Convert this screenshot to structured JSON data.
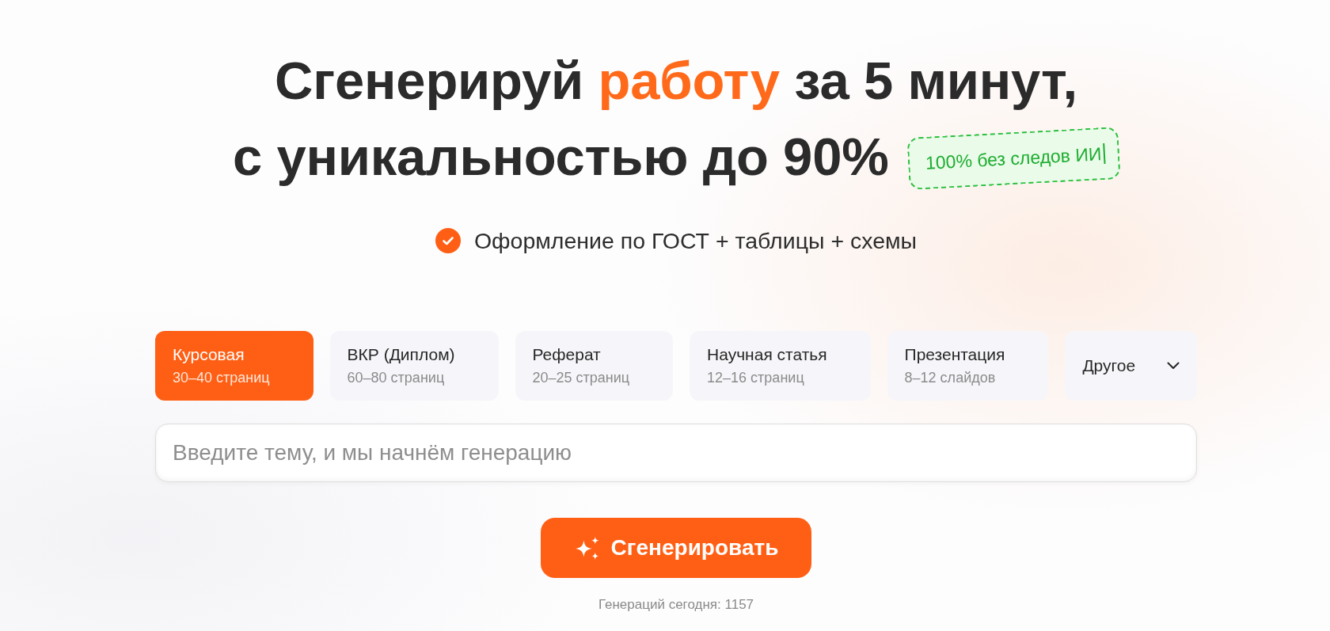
{
  "headline": {
    "lines": [
      {
        "segments": [
          {
            "text": "Сгенерируй ",
            "accent": false
          },
          {
            "text": "работу",
            "accent": true
          },
          {
            "text": " за 5 минут,",
            "accent": false
          }
        ]
      },
      {
        "segments": [
          {
            "text": "с уникальностью до 90%",
            "accent": false
          }
        ],
        "badge": {
          "text": "100% без следов ИИ",
          "caret": true
        }
      }
    ]
  },
  "feature": {
    "text": "Оформление по ГОСТ + таблицы + схемы",
    "checked": true
  },
  "tabs": [
    {
      "kind": "option",
      "title": "Курсовая",
      "subtitle": "30–40 страниц",
      "selected": true
    },
    {
      "kind": "option",
      "title": "ВКР (Диплом)",
      "subtitle": "60–80 страниц",
      "selected": false
    },
    {
      "kind": "option",
      "title": "Реферат",
      "subtitle": "20–25 страниц",
      "selected": false
    },
    {
      "kind": "option",
      "title": "Научная статья",
      "subtitle": "12–16 страниц",
      "selected": false
    },
    {
      "kind": "option",
      "title": "Презентация",
      "subtitle": "8–12 слайдов",
      "selected": false
    },
    {
      "kind": "dropdown",
      "title": "Другое",
      "selected": false
    }
  ],
  "topic_input": {
    "placeholder": "Введите тему, и мы начнём генерацию"
  },
  "generate_button": {
    "label": "Сгенерировать"
  },
  "counter": "Генераций сегодня: 1157"
}
